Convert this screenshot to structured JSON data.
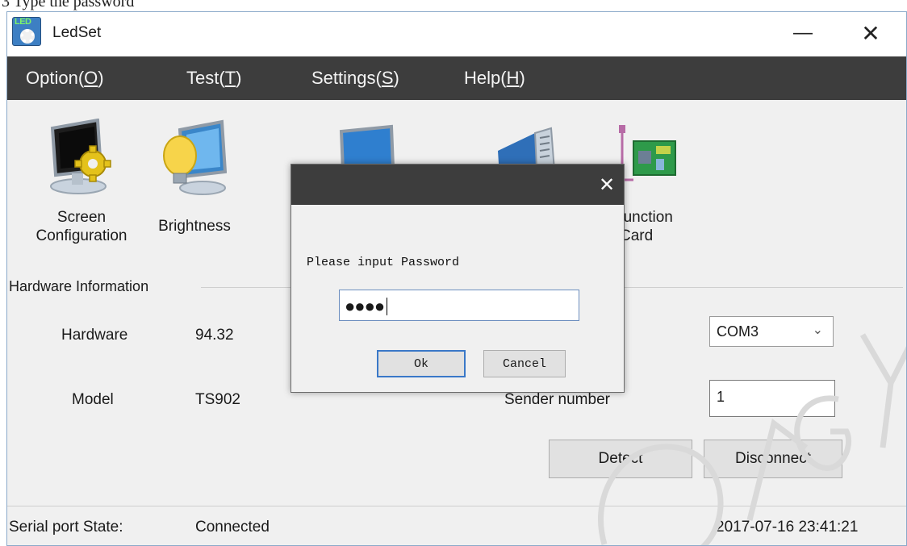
{
  "caption": "3 Type the password",
  "window": {
    "title": "LedSet",
    "icon_text": "LED",
    "minimize_glyph": "—",
    "close_glyph": "✕"
  },
  "menu": [
    {
      "label": "Option(",
      "hotkey": "O",
      "suffix": ")"
    },
    {
      "label": "Test(",
      "hotkey": "T",
      "suffix": ")"
    },
    {
      "label": "Settings(",
      "hotkey": "S",
      "suffix": ")"
    },
    {
      "label": "Help(",
      "hotkey": "H",
      "suffix": ")"
    }
  ],
  "toolbar": {
    "screen_config": {
      "line1": "Screen",
      "line2": "Configuration",
      "icon": "monitor-gear-icon"
    },
    "brightness": {
      "line1": "Brightness",
      "icon": "lightbulb-monitor-icon"
    },
    "multifunction": {
      "line1": "-function",
      "line2": "Card",
      "icon": "circuit-card-icon"
    }
  },
  "hardware": {
    "section_title": "Hardware Information",
    "hardware_label": "Hardware",
    "hardware_value": "94.32",
    "model_label": "Model",
    "model_value": "TS902"
  },
  "connection": {
    "com_port": "COM3",
    "sender_label": "Sender number",
    "sender_value": "1",
    "detect_label": "Detect",
    "disconnect_label": "Disconnect"
  },
  "status": {
    "label": "Serial port State:",
    "value": "Connected",
    "timestamp": "2017-07-16 23:41:21"
  },
  "dialog": {
    "close_glyph": "✕",
    "prompt": "Please input Password",
    "password_masked": "●●●●",
    "ok_label": "Ok",
    "cancel_label": "Cancel"
  },
  "colors": {
    "menubar_bg": "#3d3d3d",
    "window_bg": "#f0f0f0",
    "accent_blue": "#3a78c8"
  }
}
